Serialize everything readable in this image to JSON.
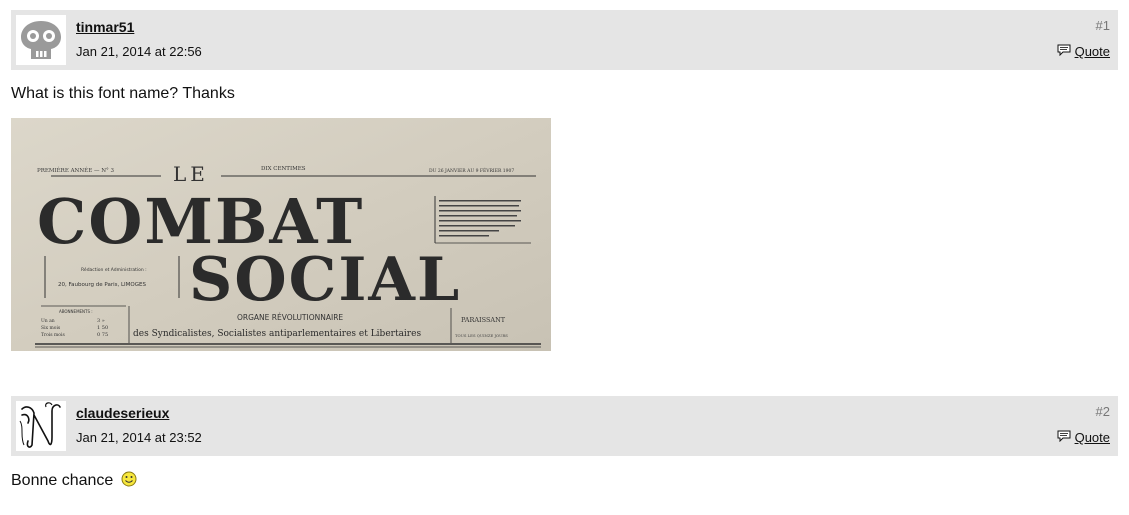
{
  "posts": [
    {
      "username": "tinmar51",
      "timestamp": "Jan 21, 2014 at 22:56",
      "number": "#1",
      "quote_label": "Quote",
      "avatar_icon": "skull-icon",
      "body": "What is this font name? Thanks",
      "image": {
        "icon": "newspaper-masthead-image",
        "top_left": "PREMIÈRE ANNÉE — N° 3",
        "le": "LE",
        "price": "DIX CENTIMES",
        "dates": "DU 26 JANVIER AU 9 FÉVRIER 1907",
        "title_line1": "COMBAT",
        "title_line2": "SOCIAL",
        "address_label": "Rédaction et Administration :",
        "address": "20, Faubourg de Paris, LIMOGES",
        "subscriptions_label": "ABONNEMENTS :",
        "subscriptions": [
          {
            "term": "Un an",
            "price": "3 »"
          },
          {
            "term": "Six mois",
            "price": "1 50"
          },
          {
            "term": "Trois mois",
            "price": "0 75"
          }
        ],
        "organ": "ORGANE RÉVOLUTIONNAIRE",
        "subtitle": "des Syndicalistes, Socialistes antiparlementaires et Libertaires",
        "frequency": "PARAISSANT",
        "frequency_sub": "TOUS LES QUINZE JOURS"
      }
    },
    {
      "username": "claudeserieux",
      "timestamp": "Jan 21, 2014 at 23:52",
      "number": "#2",
      "quote_label": "Quote",
      "avatar_icon": "calligraphic-n-icon",
      "body": "Bonne chance",
      "emoji": "smiley-icon"
    }
  ]
}
